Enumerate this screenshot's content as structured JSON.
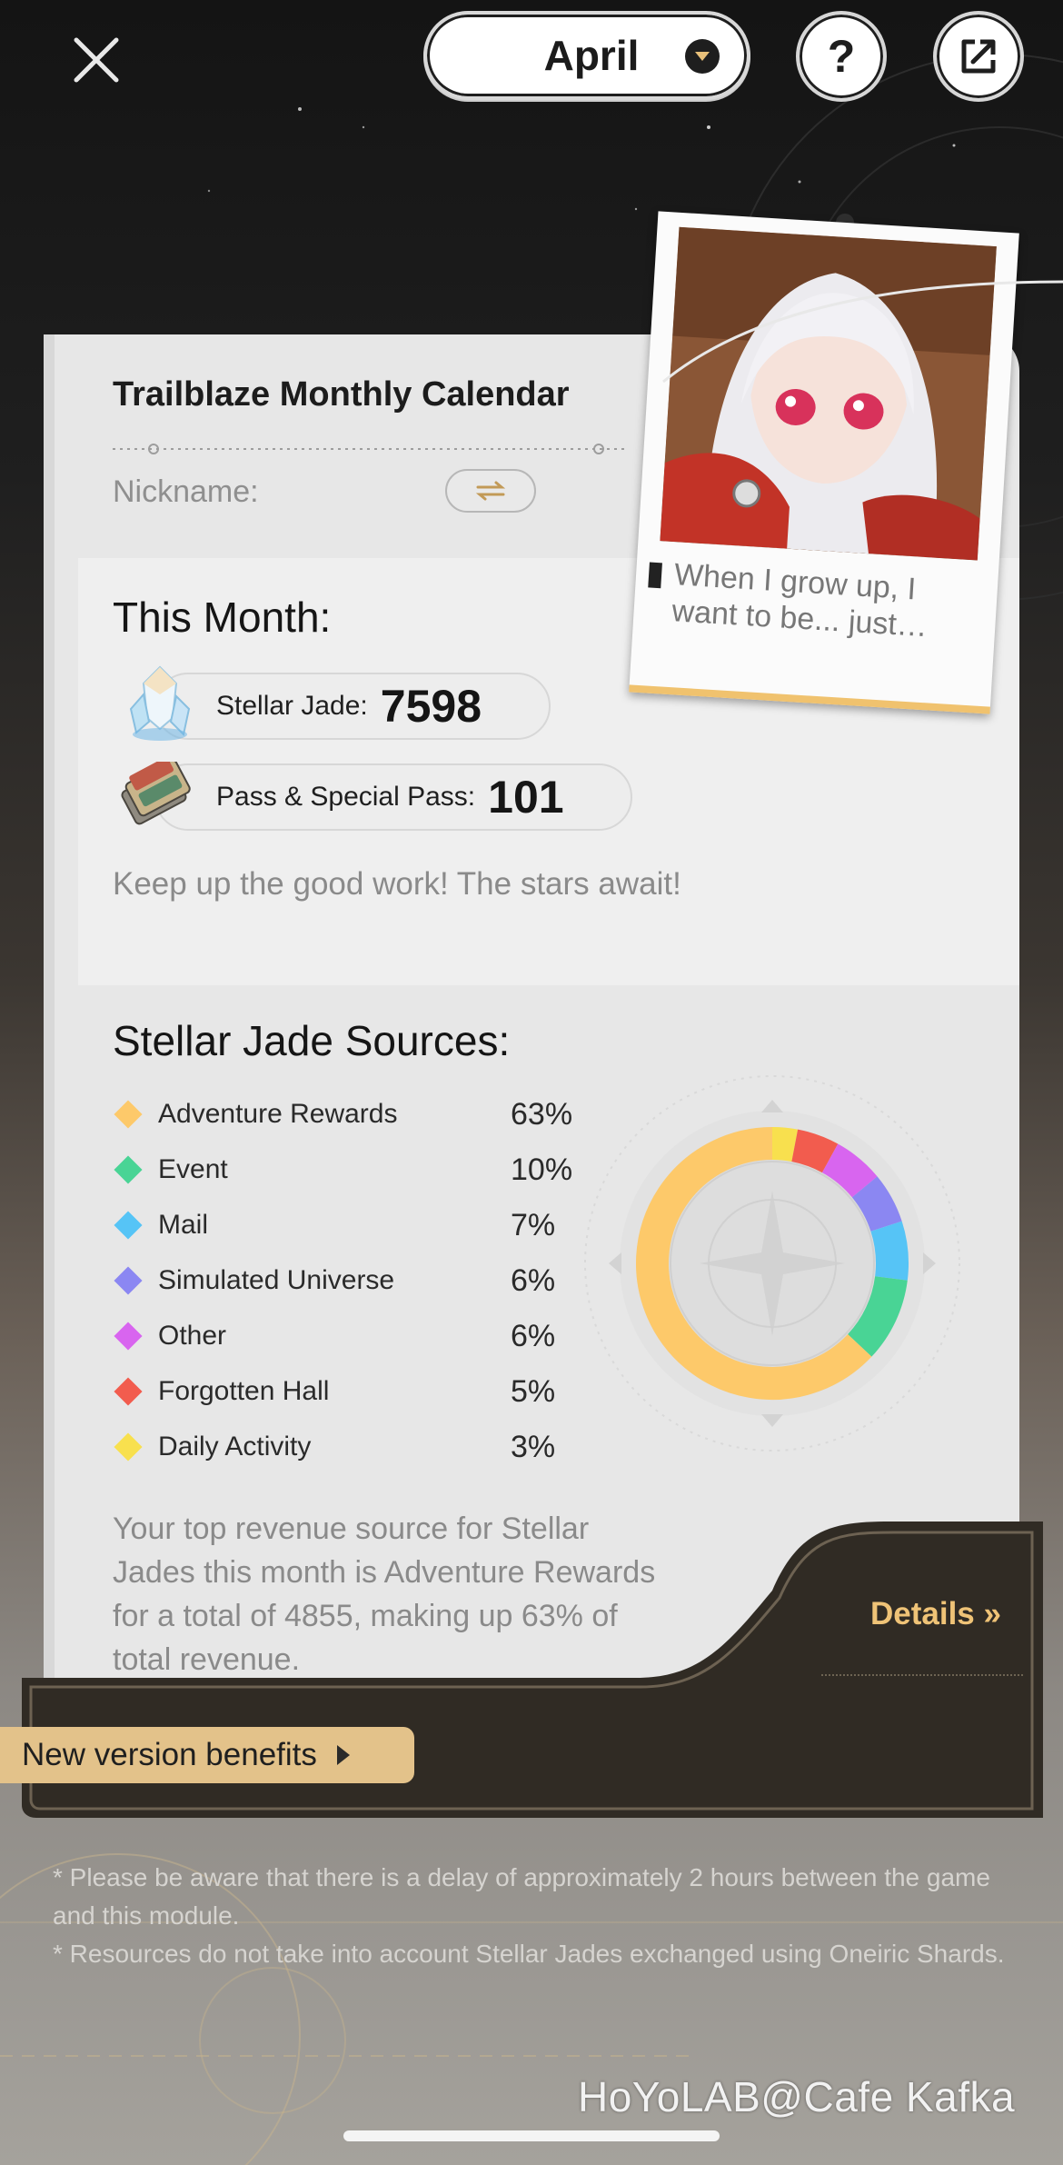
{
  "topbar": {
    "month": "April",
    "help_label": "?"
  },
  "card": {
    "title": "Trailblaze Monthly Calendar",
    "nickname_label": "Nickname:"
  },
  "this_month": {
    "title": "This Month:",
    "stellar_jade_label": "Stellar Jade:",
    "stellar_jade_value": "7598",
    "pass_label": "Pass & Special Pass:",
    "pass_value": "101",
    "encouragement": "Keep up the good work! The stars await!"
  },
  "photo": {
    "quote": "When I grow up, I want to be... just…"
  },
  "sources": {
    "title": "Stellar Jade Sources:",
    "items": [
      {
        "name": "Adventure Rewards",
        "percent": "63%",
        "value": 63,
        "color": "#fdc96a"
      },
      {
        "name": "Event",
        "percent": "10%",
        "value": 10,
        "color": "#49d495"
      },
      {
        "name": "Mail",
        "percent": "7%",
        "value": 7,
        "color": "#56c4f6"
      },
      {
        "name": "Simulated Universe",
        "percent": "6%",
        "value": 6,
        "color": "#8b87f2"
      },
      {
        "name": "Other",
        "percent": "6%",
        "value": 6,
        "color": "#d865ef"
      },
      {
        "name": "Forgotten Hall",
        "percent": "5%",
        "value": 5,
        "color": "#f25c4e"
      },
      {
        "name": "Daily Activity",
        "percent": "3%",
        "value": 3,
        "color": "#f8e04e"
      }
    ],
    "summary": "Your top revenue source for Stellar Jades this month is Adventure Rewards for a total of 4855, making up 63% of total revenue."
  },
  "details_label": "Details »",
  "new_version_benefits": "New version benefits",
  "notes": [
    "* Please be aware that there is a delay of approximately 2 hours between the game and this module.",
    "* Resources do not take into account Stellar Jades exchanged using Oneiric Shards."
  ],
  "watermark": "HoYoLAB@Cafe Kafka",
  "colors": {
    "accent_gold": "#efc377",
    "banner_gold": "#e3c28a",
    "panel_dark": "#302b24"
  }
}
